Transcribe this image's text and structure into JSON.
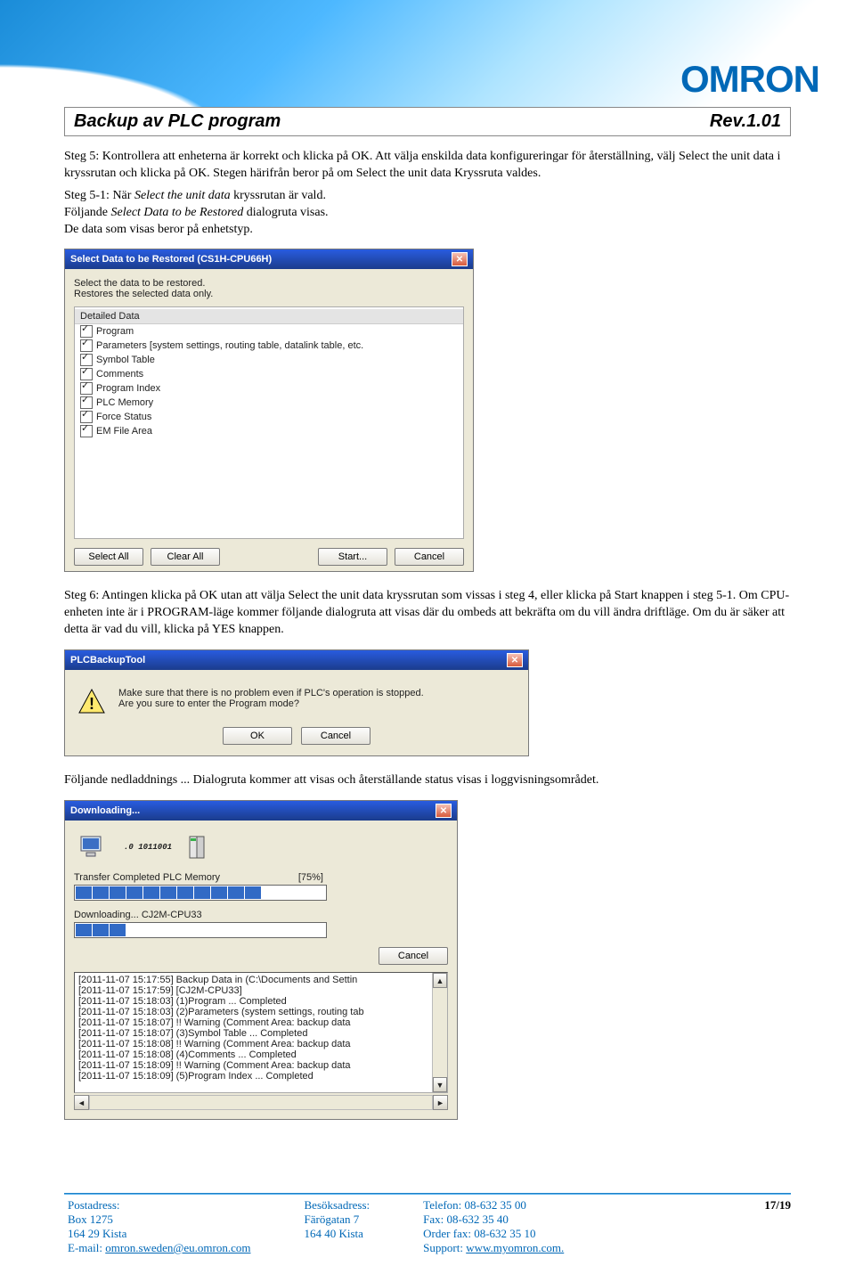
{
  "header": {
    "brand": "OMRON",
    "title_left": "Backup av PLC program",
    "title_right": "Rev.1.01"
  },
  "body": {
    "p1": "Steg 5: Kontrollera att enheterna är korrekt och klicka på OK. Att välja enskilda data konfigureringar för återställning, välj Select the unit data i kryssrutan och klicka på OK. Stegen härifrån beror på om Select the unit data Kryssruta valdes.",
    "p2a": "Steg 5-1: När ",
    "p2a_i": "Select the unit data",
    "p2a_end": " kryssrutan är vald.",
    "p2b": "Följande ",
    "p2b_i": "Select Data to be Restored",
    "p2b_end": " dialogruta visas.",
    "p2c": "De data som visas beror på enhetstyp.",
    "p3": "Steg 6: Antingen klicka på OK utan att välja Select the unit data kryssrutan som vissas i steg 4, eller klicka på Start knappen i steg 5-1. Om CPU-enheten inte är i PROGRAM-läge kommer följande dialogruta att visas där du ombeds att bekräfta om du vill ändra driftläge. Om du är säker att detta är vad du vill, klicka på YES knappen.",
    "p4": "Följande nedladdnings ... Dialogruta kommer att visas och återställande status visas i loggvisningsområdet."
  },
  "dialogs": {
    "select_restore": {
      "title": "Select Data to be Restored (CS1H-CPU66H)",
      "desc1": "Select the data to be restored.",
      "desc2": "Restores the selected data only.",
      "group_header": "Detailed Data",
      "items": [
        "Program",
        "Parameters [system settings, routing table, datalink table, etc.",
        "Symbol Table",
        "Comments",
        "Program Index",
        "PLC Memory",
        "Force Status",
        "EM File Area"
      ],
      "buttons": {
        "select_all": "Select All",
        "clear_all": "Clear All",
        "start": "Start...",
        "cancel": "Cancel"
      }
    },
    "confirm": {
      "title": "PLCBackupTool",
      "line1": "Make sure that there is no problem even if PLC's operation is stopped.",
      "line2": "Are you sure to enter the Program mode?",
      "ok": "OK",
      "cancel": "Cancel"
    },
    "download": {
      "title": "Downloading...",
      "binary": ".0 1011001",
      "row1_label": "Transfer Completed PLC Memory",
      "row1_pct": "[75%]",
      "row2_label": "Downloading... CJ2M-CPU33",
      "cancel": "Cancel",
      "log": [
        "[2011-11-07 15:17:55] Backup Data in (C:\\Documents and Settin",
        "[2011-11-07 15:17:59] [CJ2M-CPU33]",
        "[2011-11-07 15:18:03]   (1)Program      ... Completed",
        "[2011-11-07 15:18:03]   (2)Parameters (system settings, routing tab",
        "[2011-11-07 15:18:07]   !! Warning (Comment Area: backup data",
        "[2011-11-07 15:18:07]   (3)Symbol Table    ... Completed",
        "[2011-11-07 15:18:08]   !! Warning (Comment Area: backup data",
        "[2011-11-07 15:18:08]   (4)Comments    ... Completed",
        "[2011-11-07 15:18:09]   !! Warning (Comment Area: backup data",
        "[2011-11-07 15:18:09]   (5)Program Index    ... Completed"
      ]
    }
  },
  "footer": {
    "postadress_label": "Postadress:",
    "box": "Box 1275",
    "zip1": "164 29 Kista",
    "email_label": "E-mail: ",
    "email": "omron.sweden@eu.omron.com",
    "besok_label": "Besöksadress:",
    "street": "Färögatan 7",
    "zip2": "164 40 Kista",
    "tel": "Telefon:   08-632 35 00",
    "fax": "Fax:         08-632 35 40",
    "orderfax": "Order fax: 08-632 35 10",
    "support_label": "Support: ",
    "support": "www.myomron.com.",
    "page": "17/19"
  }
}
